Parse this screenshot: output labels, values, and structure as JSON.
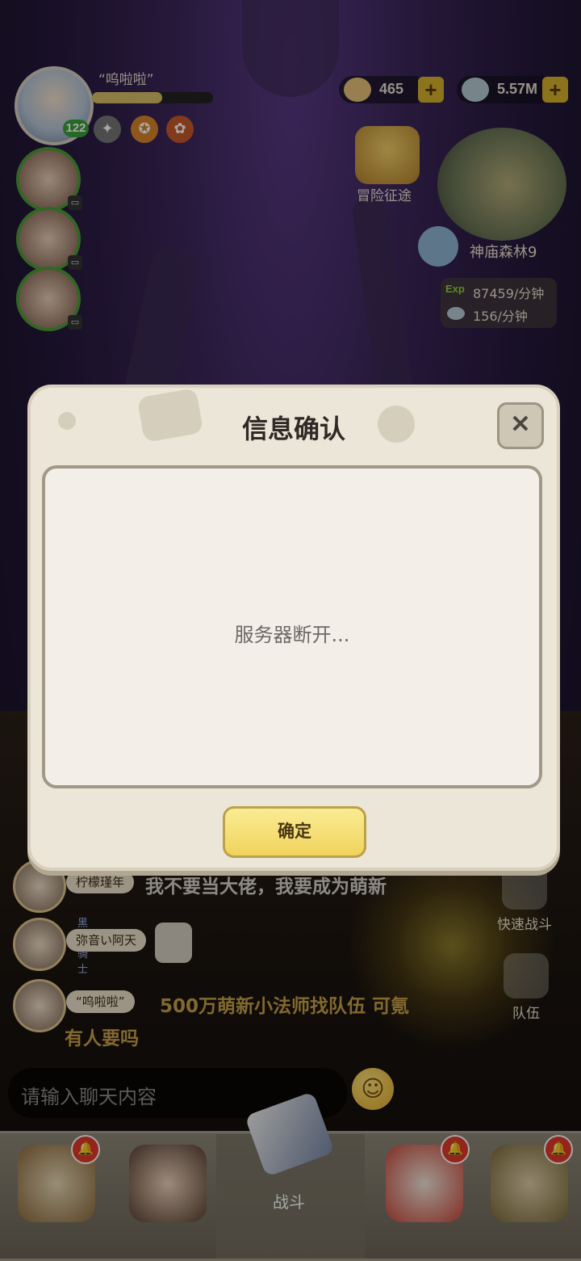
{
  "player": {
    "name": "“呜啦啦”",
    "level": "122",
    "exp_fraction": 0.58
  },
  "currencies": [
    {
      "name": "food",
      "value": "465"
    },
    {
      "name": "gems",
      "value": "5.57M"
    }
  ],
  "adventure_label": "冒险征途",
  "map": {
    "label": "神庙森林9",
    "exp_tag": "Exp",
    "exp_rate": "87459/分钟",
    "gem_rate": "156/分钟"
  },
  "chat": {
    "messages": [
      {
        "name": "柠檬瑾年",
        "text": "我不要当大佬，我要成为萌新",
        "color": "#d8d4cc"
      },
      {
        "name": "弥音い阿天",
        "title": "黑暗骑士",
        "text": "",
        "color": "#d8d4cc"
      },
      {
        "name": "“呜啦啦”",
        "text": "500万萌新小法师找队伍 可氪",
        "text2": "有人要吗",
        "color": "#c9a24a"
      }
    ],
    "input_placeholder": "请输入聊天内容"
  },
  "side_buttons": {
    "quick_battle": "快速战斗",
    "team": "队伍"
  },
  "nav": {
    "battle": "战斗"
  },
  "dialog": {
    "title": "信息确认",
    "message": "服务器断开...",
    "confirm": "确定",
    "close": "✕"
  }
}
